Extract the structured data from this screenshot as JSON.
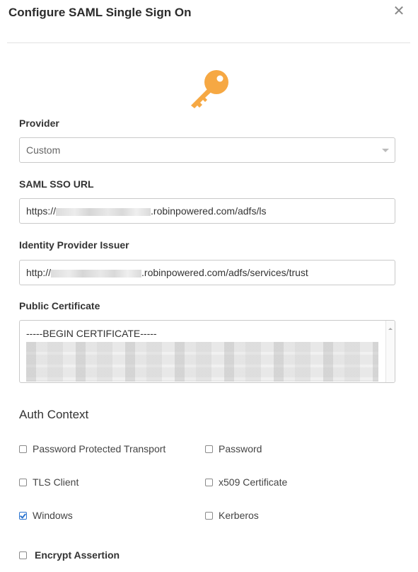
{
  "dialog": {
    "title": "Configure SAML Single Sign On",
    "close_glyph": "✕"
  },
  "icons": {
    "header_icon": "key-icon",
    "close_icon": "close-icon"
  },
  "colors": {
    "key": "#f6a843",
    "checkbox_checked": "#2a74d0"
  },
  "provider": {
    "label": "Provider",
    "value": "Custom"
  },
  "saml_sso_url": {
    "label": "SAML SSO URL",
    "prefix": "https://",
    "suffix": ".robinpowered.com/adfs/ls"
  },
  "idp_issuer": {
    "label": "Identity Provider Issuer",
    "prefix": "http://",
    "suffix": ".robinpowered.com/adfs/services/trust"
  },
  "certificate": {
    "label": "Public Certificate",
    "first_line": "-----BEGIN CERTIFICATE-----"
  },
  "auth_context": {
    "heading": "Auth Context",
    "options": [
      {
        "label": "Password Protected Transport",
        "checked": false
      },
      {
        "label": "Password",
        "checked": false
      },
      {
        "label": "TLS Client",
        "checked": false
      },
      {
        "label": "x509 Certificate",
        "checked": false
      },
      {
        "label": "Windows",
        "checked": true
      },
      {
        "label": "Kerberos",
        "checked": false
      }
    ]
  },
  "encrypt_assertion": {
    "label": "Encrypt Assertion",
    "checked": false
  }
}
